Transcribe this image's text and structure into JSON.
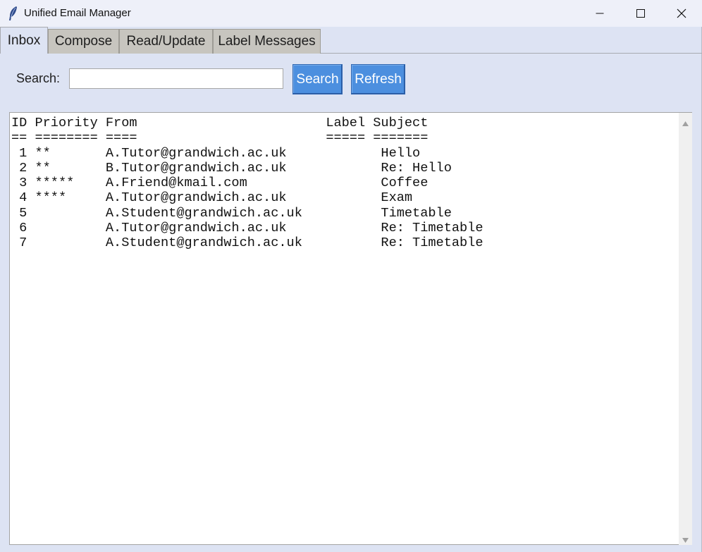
{
  "window": {
    "title": "Unified Email Manager",
    "icon": "feather-icon"
  },
  "tabs": [
    {
      "label": "Inbox",
      "active": true
    },
    {
      "label": "Compose",
      "active": false
    },
    {
      "label": "Read/Update",
      "active": false
    },
    {
      "label": "Label Messages",
      "active": false
    }
  ],
  "search": {
    "label": "Search:",
    "value": "",
    "search_button": "Search",
    "refresh_button": "Refresh"
  },
  "listing": {
    "header": "ID Priority From                        Label Subject",
    "underline": "== ======== ====                        ===== =======",
    "rows": [
      " 1 **       A.Tutor@grandwich.ac.uk            Hello",
      " 2 **       B.Tutor@grandwich.ac.uk            Re: Hello",
      " 3 *****    A.Friend@kmail.com                 Coffee",
      " 4 ****     A.Tutor@grandwich.ac.uk            Exam",
      " 5          A.Student@grandwich.ac.uk          Timetable",
      " 6          A.Tutor@grandwich.ac.uk            Re: Timetable",
      " 7          A.Student@grandwich.ac.uk          Re: Timetable"
    ]
  },
  "colors": {
    "accent_button": "#4c8fdf",
    "window_bg": "#dde3f3",
    "inactive_tab": "#c7c5bf"
  }
}
